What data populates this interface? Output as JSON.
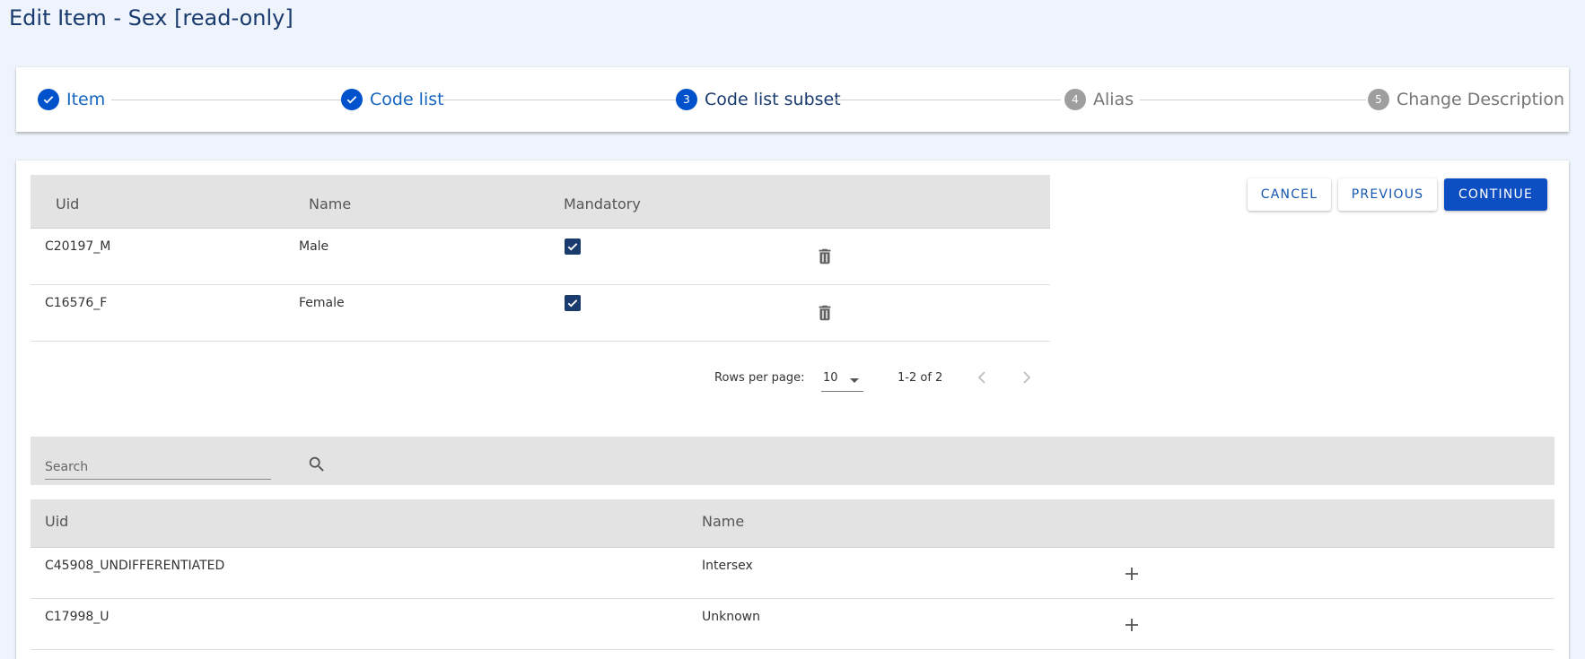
{
  "page": {
    "title": "Edit Item - Sex [read-only]"
  },
  "stepper": {
    "steps": [
      {
        "label": "Item",
        "number": "1",
        "status": "done"
      },
      {
        "label": "Code list",
        "number": "2",
        "status": "done"
      },
      {
        "label": "Code list subset",
        "number": "3",
        "status": "active"
      },
      {
        "label": "Alias",
        "number": "4",
        "status": "pending"
      },
      {
        "label": "Change Description",
        "number": "5",
        "status": "pending"
      }
    ]
  },
  "actions": {
    "cancel": "CANCEL",
    "previous": "PREVIOUS",
    "continue": "CONTINUE"
  },
  "selected_table": {
    "columns": [
      "Uid",
      "Name",
      "Mandatory"
    ],
    "rows": [
      {
        "uid": "C20197_M",
        "name": "Male",
        "mandatory": true
      },
      {
        "uid": "C16576_F",
        "name": "Female",
        "mandatory": true
      }
    ],
    "pagination": {
      "rows_per_page_label": "Rows per page:",
      "rows_per_page": "10",
      "range": "1-2 of 2"
    }
  },
  "search": {
    "placeholder": "Search"
  },
  "available_table": {
    "columns": [
      "Uid",
      "Name"
    ],
    "rows": [
      {
        "uid": "C45908_UNDIFFERENTIATED",
        "name": "Intersex"
      },
      {
        "uid": "C17998_U",
        "name": "Unknown"
      }
    ]
  },
  "colors": {
    "accent": "#0d4fc2",
    "title": "#1a3b6e",
    "background": "#eff4fc"
  }
}
